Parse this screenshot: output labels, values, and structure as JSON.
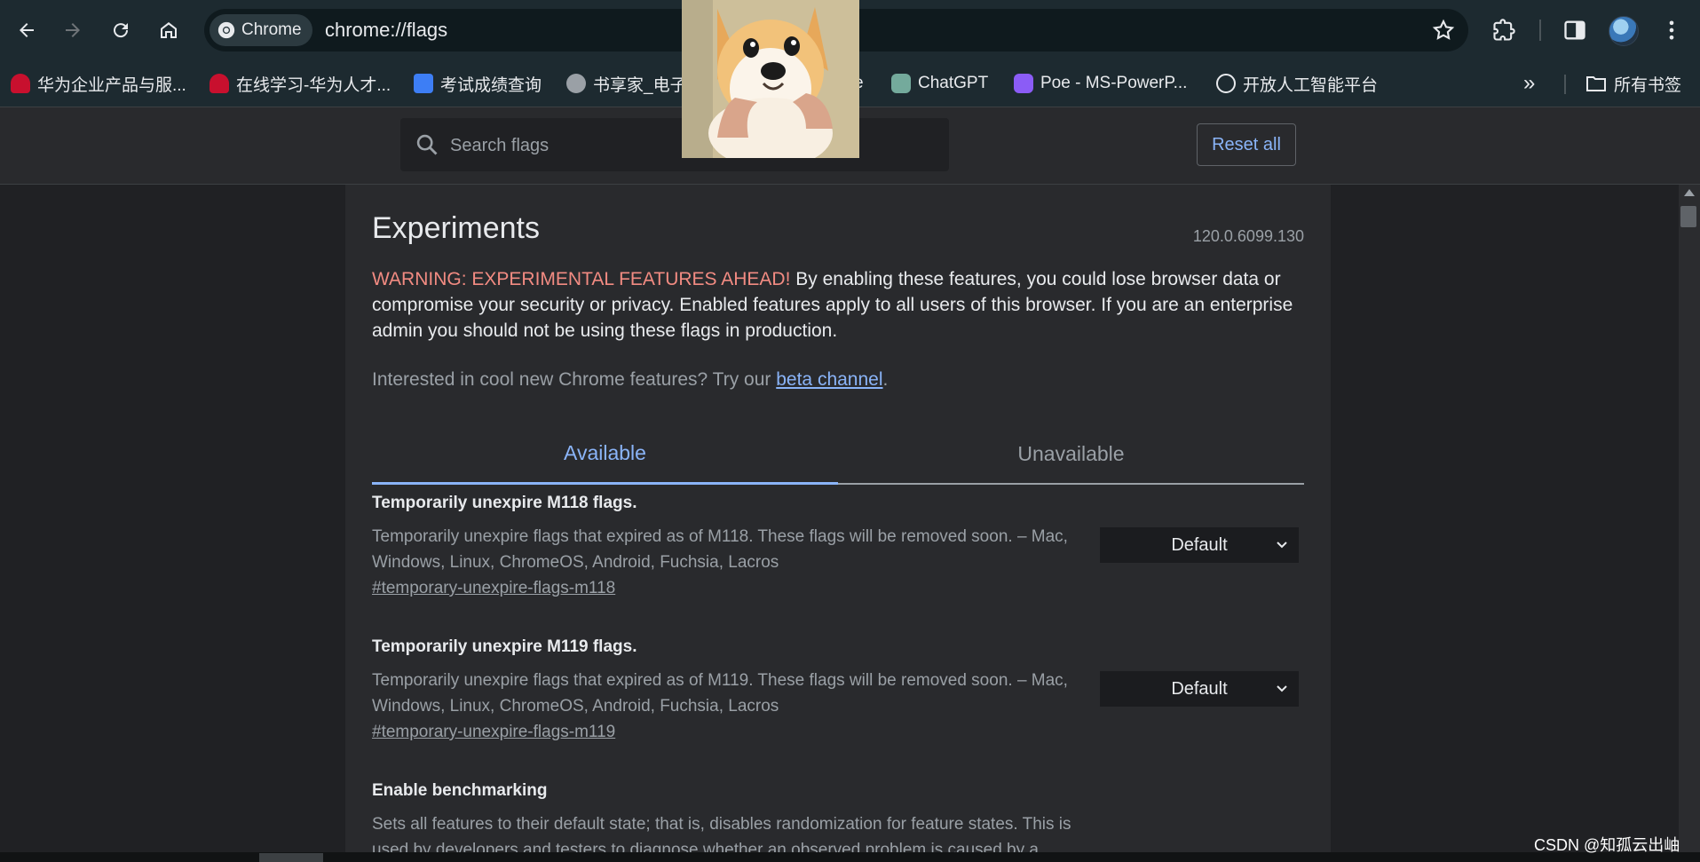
{
  "browser": {
    "chip_label": "Chrome",
    "url": "chrome://flags",
    "bookmarks": [
      "华为企业产品与服...",
      "在线学习-华为人才...",
      "考试成绩查询",
      "书享家_电子",
      "e",
      "ChatGPT",
      "Poe - MS-PowerP...",
      "开放人工智能平台"
    ],
    "more_bookmarks_label": "»",
    "all_bookmarks": "所有书签"
  },
  "header": {
    "search_placeholder": "Search flags",
    "reset_label": "Reset all"
  },
  "page": {
    "title": "Experiments",
    "version": "120.0.6099.130",
    "warning_prefix": "WARNING: EXPERIMENTAL FEATURES AHEAD!",
    "warning_text": " By enabling these features, you could lose browser data or compromise your security or privacy. Enabled features apply to all users of this browser. If you are an enterprise admin you should not be using these flags in production.",
    "cool_text": "Interested in cool new Chrome features? Try our ",
    "beta_link": "beta channel",
    "cool_suffix": ".",
    "tabs": [
      "Available",
      "Unavailable"
    ]
  },
  "flags": [
    {
      "name": "Temporarily unexpire M118 flags.",
      "desc": "Temporarily unexpire flags that expired as of M118. These flags will be removed soon. – Mac, Windows, Linux, ChromeOS, Android, Fuchsia, Lacros",
      "link": "#temporary-unexpire-flags-m118",
      "value": "Default"
    },
    {
      "name": "Temporarily unexpire M119 flags.",
      "desc": "Temporarily unexpire flags that expired as of M119. These flags will be removed soon. – Mac, Windows, Linux, ChromeOS, Android, Fuchsia, Lacros",
      "link": "#temporary-unexpire-flags-m119",
      "value": "Default"
    },
    {
      "name": "Enable benchmarking",
      "desc": "Sets all features to their default state; that is, disables randomization for feature states. This is used by developers and testers to diagnose whether an observed problem is caused by a"
    }
  ],
  "watermark": "CSDN @知孤云出岫",
  "colors": {
    "toolbar": "#1d2a30",
    "accent": "#8ab4f8",
    "warning": "#f28b82"
  }
}
